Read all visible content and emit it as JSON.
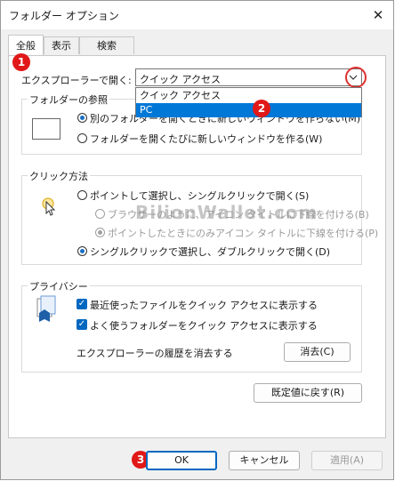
{
  "window": {
    "title": "フォルダー オプション",
    "close_glyph": "✕"
  },
  "tabs": [
    "全般",
    "表示",
    "検索"
  ],
  "open_explorer": {
    "label": "エクスプローラーで開く:",
    "selected": "クイック アクセス",
    "options": [
      "クイック アクセス",
      "PC"
    ]
  },
  "browse": {
    "title": "フォルダーの参照",
    "option1": "別のフォルダーを開くときに新しいウィンドウを作らない(M)",
    "option2": "フォルダーを開くたびに新しいウィンドウを作る(W)"
  },
  "click": {
    "title": "クリック方法",
    "single": "ポイントして選択し、シングルクリックで開く(S)",
    "sub1": "ブラウザーのように、アイコン タイトルに下線を付ける(B)",
    "sub2": "ポイントしたときにのみアイコン タイトルに下線を付ける(P)",
    "double": "シングルクリックで選択し、ダブルクリックで開く(D)"
  },
  "privacy": {
    "title": "プライバシー",
    "check1": "最近使ったファイルをクイック アクセスに表示する",
    "check2": "よく使うフォルダーをクイック アクセスに表示する",
    "clear_label": "エクスプローラーの履歴を消去する",
    "clear_button": "消去(C)"
  },
  "restore_button": "既定値に戻す(R)",
  "footer": {
    "ok": "OK",
    "cancel": "キャンセル",
    "apply": "適用(A)"
  },
  "badges": [
    "1",
    "2",
    "3"
  ],
  "watermark": "BilionWallet.com",
  "colors": {
    "accent": "#0067c0",
    "selection": "#0078d7",
    "badge": "#e01818"
  }
}
